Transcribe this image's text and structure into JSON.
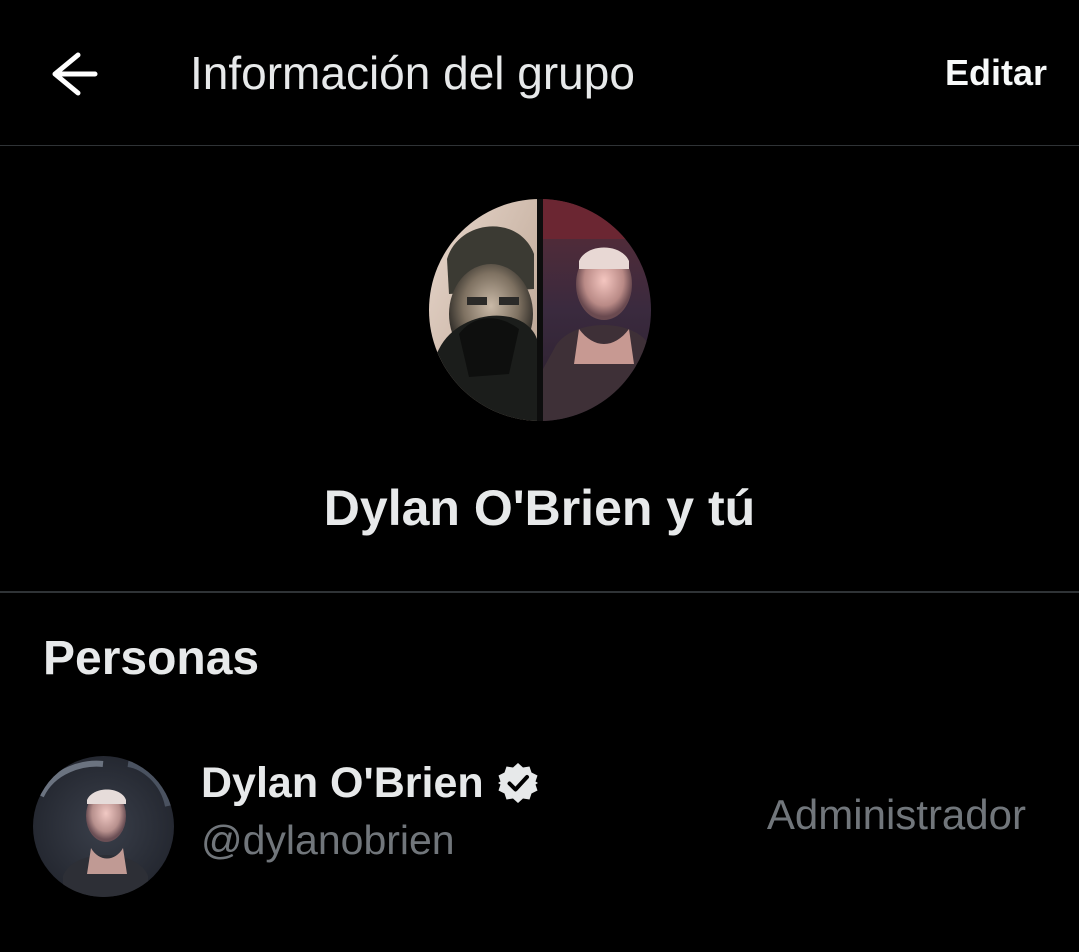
{
  "header": {
    "back_icon": "arrow-left-icon",
    "title": "Información del grupo",
    "edit_label": "Editar"
  },
  "group": {
    "avatar_icon": "group-avatar-split-photo",
    "name": "Dylan O'Brien y tú"
  },
  "people_section": {
    "title": "Personas",
    "members": [
      {
        "name": "Dylan O'Brien",
        "handle": "@dylanobrien",
        "role": "Administrador",
        "verified": true,
        "verified_icon": "verified-badge-icon"
      }
    ]
  },
  "colors": {
    "background": "#000000",
    "primary_text": "#e7e9ea",
    "secondary_text": "#71767b",
    "divider": "#2f3336"
  }
}
